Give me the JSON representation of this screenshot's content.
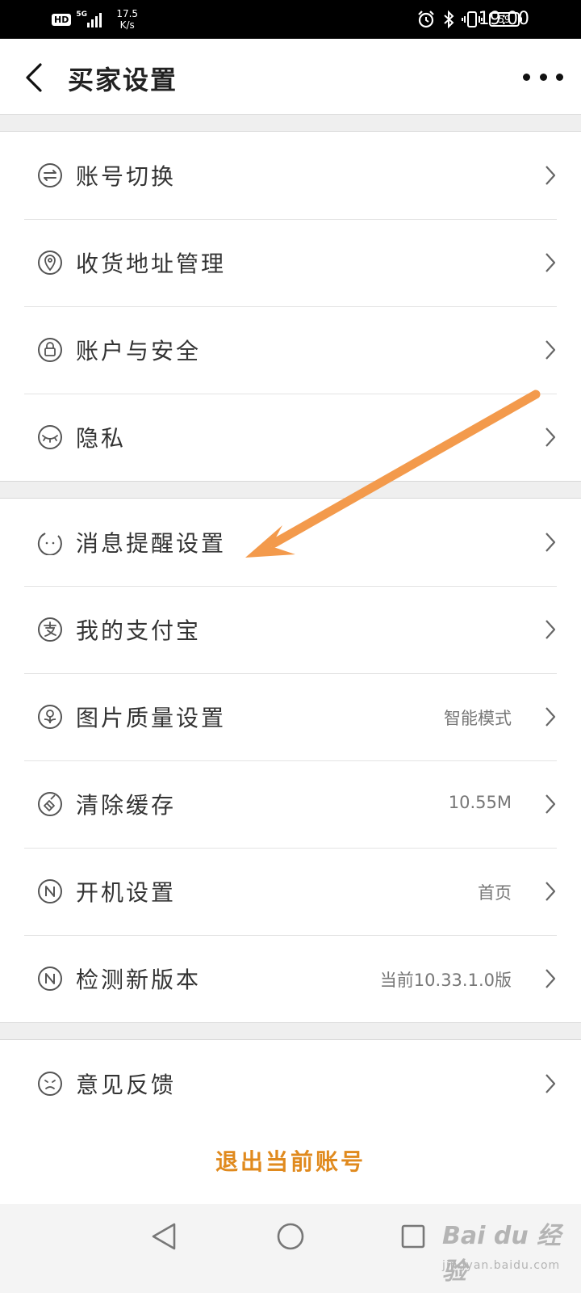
{
  "status_bar": {
    "hd": "HD",
    "network": "5G",
    "speed_value": "17.5",
    "speed_unit": "K/s",
    "battery": "59",
    "time": "19:00"
  },
  "header": {
    "title": "买家设置"
  },
  "groups": [
    [
      {
        "label": "账号切换",
        "icon": "switch-account-icon"
      },
      {
        "label": "收货地址管理",
        "icon": "location-pin-icon"
      },
      {
        "label": "账户与安全",
        "icon": "lock-icon"
      },
      {
        "label": "隐私",
        "icon": "closed-eye-icon"
      }
    ],
    [
      {
        "label": "消息提醒设置",
        "icon": "notification-face-icon"
      },
      {
        "label": "我的支付宝",
        "icon": "alipay-icon"
      },
      {
        "label": "图片质量设置",
        "icon": "image-quality-icon",
        "value": "智能模式"
      },
      {
        "label": "清除缓存",
        "icon": "clear-cache-icon",
        "value": "10.55M"
      },
      {
        "label": "开机设置",
        "icon": "startup-n-icon",
        "value": "首页"
      },
      {
        "label": "检测新版本",
        "icon": "version-n-icon",
        "value": "当前10.33.1.0版"
      }
    ],
    [
      {
        "label": "意见反馈",
        "icon": "feedback-face-icon"
      }
    ]
  ],
  "logout_label": "退出当前账号",
  "watermark": {
    "main": "Bai du 经验",
    "sub": "jingyan.baidu.com"
  },
  "colors": {
    "accent": "#e08a1e",
    "annotation_arrow": "#f39a4c",
    "status_bar": "#000000"
  }
}
